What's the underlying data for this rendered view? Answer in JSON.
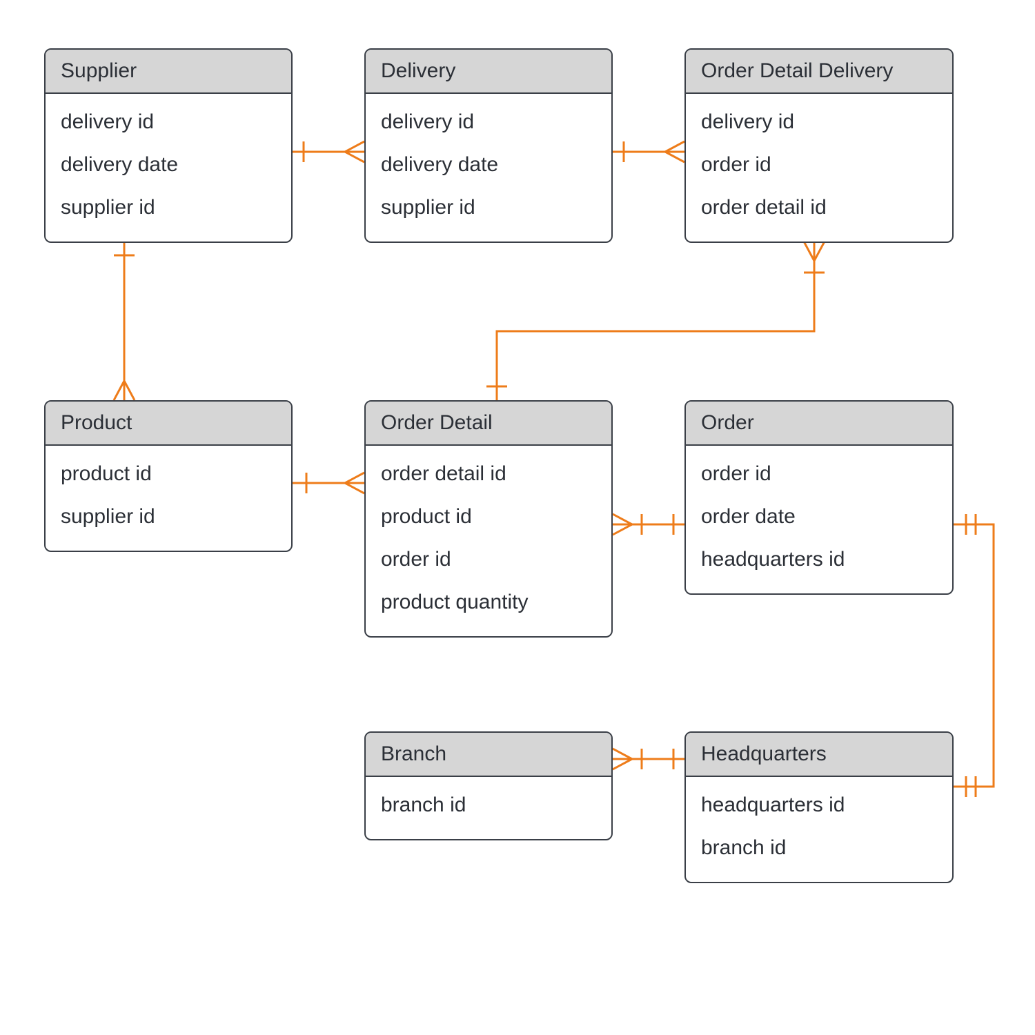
{
  "entities": {
    "supplier": {
      "title": "Supplier",
      "attrs": [
        "delivery id",
        "delivery date",
        "supplier id"
      ]
    },
    "delivery": {
      "title": "Delivery",
      "attrs": [
        "delivery id",
        "delivery date",
        "supplier id"
      ]
    },
    "orderDetailDelivery": {
      "title": "Order Detail Delivery",
      "attrs": [
        "delivery id",
        "order id",
        "order detail id"
      ]
    },
    "product": {
      "title": "Product",
      "attrs": [
        "product id",
        "supplier id"
      ]
    },
    "orderDetail": {
      "title": "Order Detail",
      "attrs": [
        "order detail id",
        "product id",
        "order id",
        "product quantity"
      ]
    },
    "order": {
      "title": "Order",
      "attrs": [
        "order id",
        "order date",
        "headquarters id"
      ]
    },
    "branch": {
      "title": "Branch",
      "attrs": [
        "branch id"
      ]
    },
    "headquarters": {
      "title": "Headquarters",
      "attrs": [
        "headquarters id",
        "branch id"
      ]
    }
  },
  "colors": {
    "connector": "#ee7c1a",
    "boxBorder": "#3a3f47",
    "titleBg": "#d6d6d6"
  }
}
